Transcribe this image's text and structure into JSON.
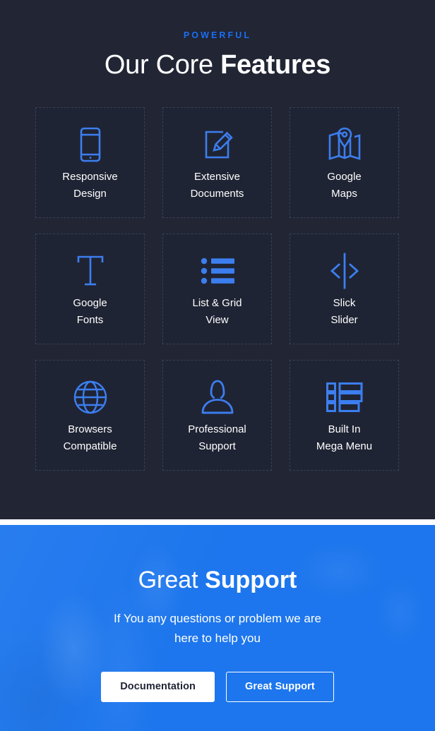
{
  "features": {
    "eyebrow": "POWERFUL",
    "title_light": "Our Core ",
    "title_bold": "Features",
    "cards": [
      {
        "icon": "mobile-icon",
        "label": "Responsive\nDesign"
      },
      {
        "icon": "pencil-edit-icon",
        "label": "Extensive\nDocuments"
      },
      {
        "icon": "map-pin-icon",
        "label": "Google\nMaps"
      },
      {
        "icon": "typography-t-icon",
        "label": "Google\nFonts"
      },
      {
        "icon": "bullet-list-icon",
        "label": "List & Grid\nView"
      },
      {
        "icon": "slider-arrows-icon",
        "label": "Slick\nSlider"
      },
      {
        "icon": "globe-icon",
        "label": "Browsers\nCompatible"
      },
      {
        "icon": "user-person-icon",
        "label": "Professional\nSupport"
      },
      {
        "icon": "menu-list-icon",
        "label": "Built In\nMega Menu"
      }
    ]
  },
  "support": {
    "title_light": "Great ",
    "title_bold": "Support",
    "subtitle": "If You any questions or problem we are here to help you",
    "buttons": {
      "documentation": "Documentation",
      "great_support": "Great Support"
    }
  },
  "colors": {
    "page_bg": "#212534",
    "card_bg": "#1f2434",
    "card_border": "#3b4052",
    "accent_blue": "#1b6ef3",
    "icon_blue": "#3c7eef",
    "support_bg": "#1d76ed",
    "text_white": "#ffffff"
  }
}
